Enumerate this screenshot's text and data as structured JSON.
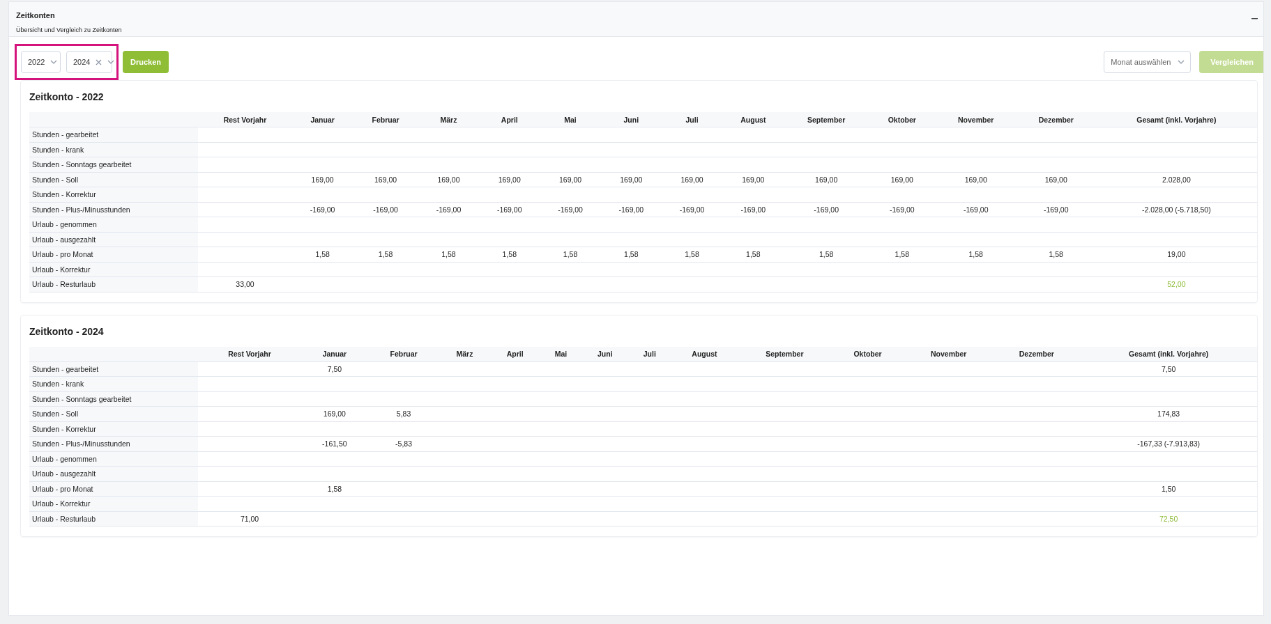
{
  "panel": {
    "title": "Zeitkonten",
    "subtitle": "Übersicht und Vergleich zu Zeitkonten"
  },
  "toolbar": {
    "highlighted": true,
    "year_selects": [
      {
        "value": "2022",
        "clearable": false
      },
      {
        "value": "2024",
        "clearable": true
      }
    ],
    "print_button": "Drucken",
    "month_select": {
      "placeholder": "Monat auswählen"
    },
    "compare_button": {
      "label": "Vergleichen",
      "disabled": true
    }
  },
  "accounts": [
    {
      "title": "Zeitkonto - 2022",
      "columns": [
        "Rest Vorjahr",
        "Januar",
        "Februar",
        "März",
        "April",
        "Mai",
        "Juni",
        "Juli",
        "August",
        "September",
        "Oktober",
        "November",
        "Dezember",
        "Gesamt (inkl. Vorjahre)"
      ],
      "rows": [
        {
          "label": "Stunden - gearbeitet",
          "kind": "standard"
        },
        {
          "label": "Stunden - krank",
          "kind": "standard"
        },
        {
          "label": "Stunden - Sonntags gearbeitet",
          "kind": "standard"
        },
        {
          "label": "Stunden - Soll",
          "kind": "standard",
          "months": [
            "169,00",
            "169,00",
            "169,00",
            "169,00",
            "169,00",
            "169,00",
            "169,00",
            "169,00",
            "169,00",
            "169,00",
            "169,00",
            "169,00"
          ],
          "total": "2.028,00"
        },
        {
          "label": "Stunden - Korrektur",
          "kind": "standard"
        },
        {
          "label": "Stunden - Plus-/Minusstunden",
          "kind": "standard",
          "months": [
            "-169,00",
            "-169,00",
            "-169,00",
            "-169,00",
            "-169,00",
            "-169,00",
            "-169,00",
            "-169,00",
            "-169,00",
            "-169,00",
            "-169,00",
            "-169,00"
          ],
          "total": "-2.028,00 (-5.718,50)"
        },
        {
          "label": "Urlaub - genommen",
          "kind": "standard"
        },
        {
          "label": "Urlaub - ausgezahlt",
          "kind": "standard"
        },
        {
          "label": "Urlaub - pro Monat",
          "kind": "standard",
          "months": [
            "1,58",
            "1,58",
            "1,58",
            "1,58",
            "1,58",
            "1,58",
            "1,58",
            "1,58",
            "1,58",
            "1,58",
            "1,58",
            "1,58"
          ],
          "total": "19,00"
        },
        {
          "label": "Urlaub - Korrektur",
          "kind": "standard"
        },
        {
          "label": "Urlaub - Resturlaub",
          "kind": "balance",
          "rest_vorjahr": "33,00",
          "total": "52,00"
        }
      ]
    },
    {
      "title": "Zeitkonto - 2024",
      "columns": [
        "Rest Vorjahr",
        "Januar",
        "Februar",
        "März",
        "April",
        "Mai",
        "Juni",
        "Juli",
        "August",
        "September",
        "Oktober",
        "November",
        "Dezember",
        "Gesamt (inkl. Vorjahre)"
      ],
      "rows": [
        {
          "label": "Stunden - gearbeitet",
          "kind": "standard",
          "months": [
            "7,50"
          ],
          "total": "7,50"
        },
        {
          "label": "Stunden - krank",
          "kind": "standard"
        },
        {
          "label": "Stunden - Sonntags gearbeitet",
          "kind": "standard"
        },
        {
          "label": "Stunden - Soll",
          "kind": "standard",
          "months": [
            "169,00",
            "5,83"
          ],
          "total": "174,83"
        },
        {
          "label": "Stunden - Korrektur",
          "kind": "standard"
        },
        {
          "label": "Stunden - Plus-/Minusstunden",
          "kind": "standard",
          "months": [
            "-161,50",
            "-5,83"
          ],
          "total": "-167,33 (-7.913,83)"
        },
        {
          "label": "Urlaub - genommen",
          "kind": "standard"
        },
        {
          "label": "Urlaub - ausgezahlt",
          "kind": "standard"
        },
        {
          "label": "Urlaub - pro Monat",
          "kind": "standard",
          "months": [
            "1,58"
          ],
          "total": "1,50"
        },
        {
          "label": "Urlaub - Korrektur",
          "kind": "standard"
        },
        {
          "label": "Urlaub - Resturlaub",
          "kind": "balance",
          "rest_vorjahr": "71,00",
          "total": "72,50"
        }
      ]
    }
  ]
}
